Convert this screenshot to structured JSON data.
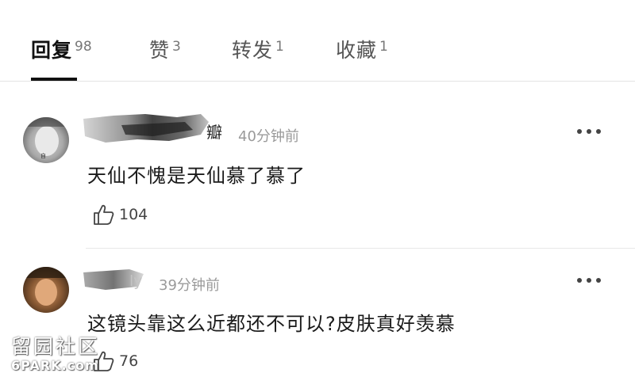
{
  "tabs": [
    {
      "label": "回复",
      "count": "98",
      "active": true
    },
    {
      "label": "赞",
      "count": "3",
      "active": false
    },
    {
      "label": "转发",
      "count": "1",
      "active": false
    },
    {
      "label": "收藏",
      "count": "1",
      "active": false
    }
  ],
  "comments": [
    {
      "username_tail": "瓣",
      "time": "40分钟前",
      "text": "天仙不愧是天仙慕了慕了",
      "likes": "104",
      "avatar_caption": "自"
    },
    {
      "username_tail": "ly",
      "time": "39分钟前",
      "text": "这镜头靠这么近都还不可以?皮肤真好羡慕",
      "likes": "76"
    }
  ],
  "watermark": {
    "chinese": "留园社区",
    "english": "6PARK.com"
  },
  "icons": {
    "like": "thumbs-up-icon",
    "more": "more-dots-icon"
  },
  "colors": {
    "active_tab": "#111111",
    "inactive_tab": "#555555",
    "time": "#9a9a9a",
    "divider": "#e8e8e8"
  }
}
